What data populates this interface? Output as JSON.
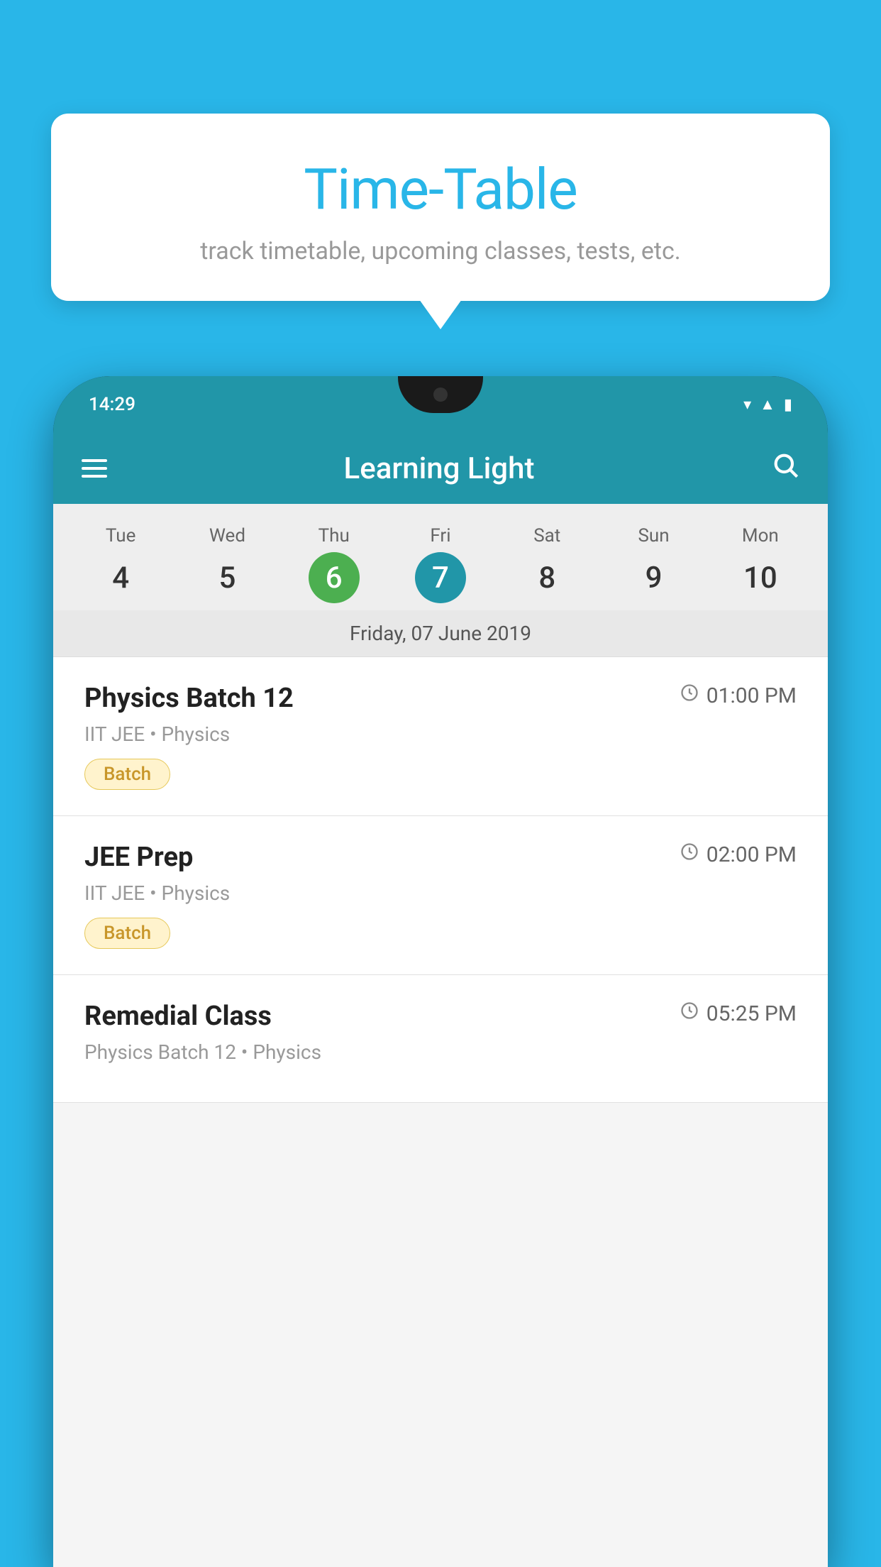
{
  "background_color": "#29b6e8",
  "tooltip": {
    "title": "Time-Table",
    "subtitle": "track timetable, upcoming classes, tests, etc."
  },
  "phone": {
    "status_time": "14:29",
    "app_title": "Learning Light",
    "calendar": {
      "days": [
        {
          "label": "Tue",
          "num": "4",
          "state": "normal"
        },
        {
          "label": "Wed",
          "num": "5",
          "state": "normal"
        },
        {
          "label": "Thu",
          "num": "6",
          "state": "today"
        },
        {
          "label": "Fri",
          "num": "7",
          "state": "selected"
        },
        {
          "label": "Sat",
          "num": "8",
          "state": "normal"
        },
        {
          "label": "Sun",
          "num": "9",
          "state": "normal"
        },
        {
          "label": "Mon",
          "num": "10",
          "state": "normal"
        }
      ],
      "selected_date": "Friday, 07 June 2019"
    },
    "classes": [
      {
        "name": "Physics Batch 12",
        "time": "01:00 PM",
        "meta": "IIT JEE • Physics",
        "badge": "Batch"
      },
      {
        "name": "JEE Prep",
        "time": "02:00 PM",
        "meta": "IIT JEE • Physics",
        "badge": "Batch"
      },
      {
        "name": "Remedial Class",
        "time": "05:25 PM",
        "meta": "Physics Batch 12 • Physics",
        "badge": null
      }
    ]
  },
  "icons": {
    "menu": "≡",
    "search": "🔍",
    "clock": "🕐"
  }
}
